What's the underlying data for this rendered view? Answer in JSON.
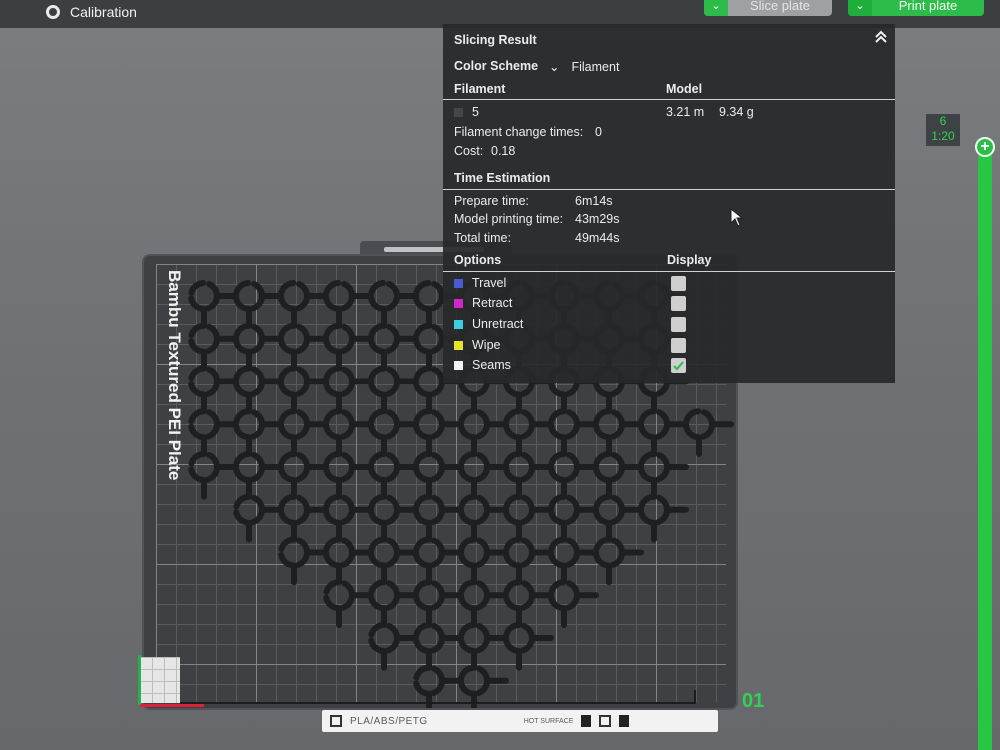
{
  "topbar": {
    "calibration_label": "Calibration",
    "slice_button_label": "Slice plate",
    "print_button_label": "Print plate"
  },
  "plate": {
    "name": "Bambu Textured PEI Plate",
    "material_label": "PLA/ABS/PETG",
    "surface_label": "HOT SURFACE",
    "plate_number": "01"
  },
  "slicing_result": {
    "title": "Slicing Result",
    "color_scheme_label": "Color Scheme",
    "color_scheme_value": "Filament",
    "filament_header": "Filament",
    "model_header": "Model",
    "filament_id": "5",
    "filament_length": "3.21 m",
    "filament_weight": "9.34 g",
    "filament_change_label": "Filament change times:",
    "filament_change_value": "0",
    "cost_label": "Cost:",
    "cost_value": "0.18",
    "time_estimation_header": "Time Estimation",
    "prepare_label": "Prepare time:",
    "prepare_value": "6m14s",
    "model_time_label": "Model printing time:",
    "model_time_value": "43m29s",
    "total_label": "Total time:",
    "total_value": "49m44s",
    "options_header": "Options",
    "display_header": "Display",
    "options": [
      {
        "label": "Travel",
        "color": "#4a5bd0",
        "checked": false
      },
      {
        "label": "Retract",
        "color": "#d126c9",
        "checked": false
      },
      {
        "label": "Unretract",
        "color": "#3ad0e0",
        "checked": false
      },
      {
        "label": "Wipe",
        "color": "#e8e22a",
        "checked": false
      },
      {
        "label": "Seams",
        "color": "#f4f4f4",
        "checked": true
      }
    ]
  },
  "layer_slider": {
    "layer": "6",
    "height": "1:20"
  },
  "colors": {
    "accent_green": "#2dbb4a",
    "panel_bg": "#26282a"
  }
}
